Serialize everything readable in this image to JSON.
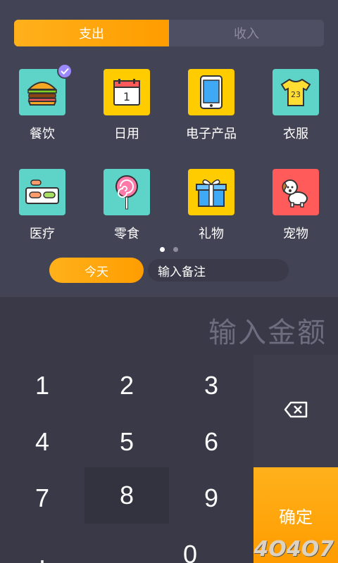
{
  "tabs": [
    {
      "label": "支出",
      "active": true
    },
    {
      "label": "收入",
      "active": false
    }
  ],
  "categories": [
    {
      "label": "餐饮",
      "icon": "burger-icon",
      "color": "#5ed3c7",
      "selected": true
    },
    {
      "label": "日用",
      "icon": "calendar-icon",
      "color": "#ffcc00",
      "selected": false
    },
    {
      "label": "电子产品",
      "icon": "phone-icon",
      "color": "#ffcc00",
      "selected": false
    },
    {
      "label": "衣服",
      "icon": "tshirt-icon",
      "color": "#5ed3c7",
      "selected": false
    },
    {
      "label": "医疗",
      "icon": "pills-icon",
      "color": "#5ed3c7",
      "selected": false
    },
    {
      "label": "零食",
      "icon": "lollipop-icon",
      "color": "#5ed3c7",
      "selected": false
    },
    {
      "label": "礼物",
      "icon": "gift-icon",
      "color": "#ffcc00",
      "selected": false
    },
    {
      "label": "宠物",
      "icon": "dog-icon",
      "color": "#ff5b5b",
      "selected": false
    }
  ],
  "pager": {
    "pages": 2,
    "current": 1
  },
  "date_button": "今天",
  "note_placeholder": "输入备注",
  "amount_placeholder": "输入金额",
  "keys": {
    "k1": "1",
    "k2": "2",
    "k3": "3",
    "k4": "4",
    "k5": "5",
    "k6": "6",
    "k7": "7",
    "k8": "8",
    "k9": "9",
    "kdot": ".",
    "k0": "0"
  },
  "confirm_label": "确定",
  "watermark": "4O4O7",
  "colors": {
    "accent": "#ffa50d",
    "background": "#434356",
    "keypad": "#393948"
  }
}
